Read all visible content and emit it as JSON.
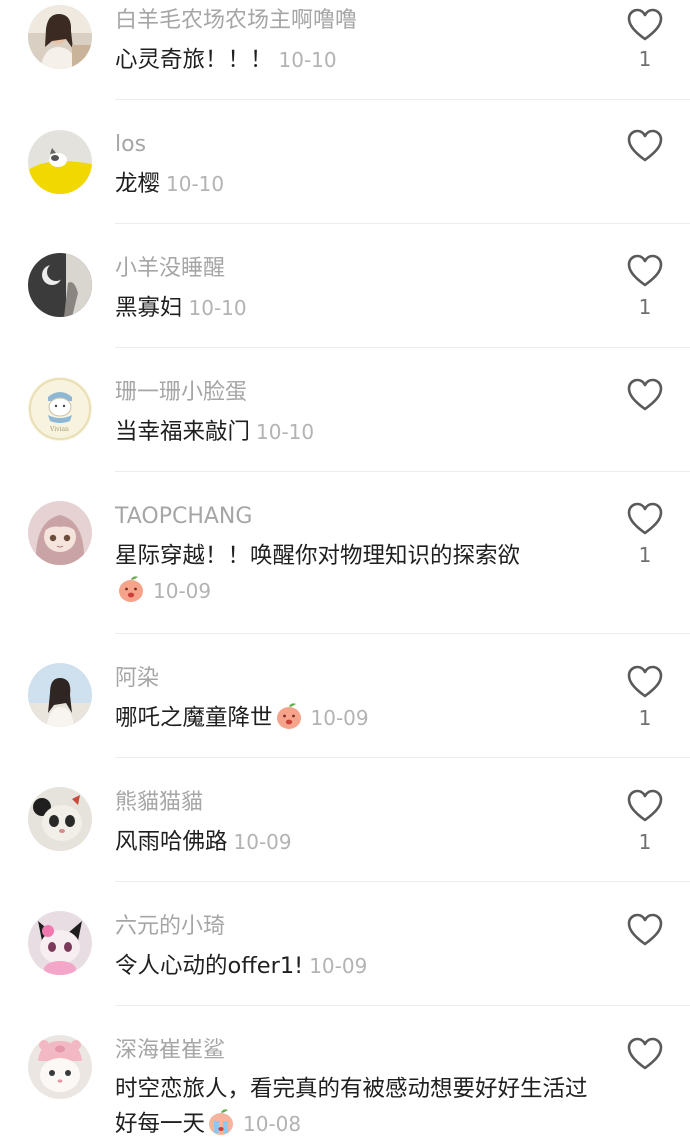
{
  "comments": [
    {
      "username": "白羊毛农场农场主啊噜噜",
      "text": "心灵奇旅！！！",
      "date": "10-10",
      "likes": "1",
      "avatar": "woman-selfie-avatar",
      "emoji": ""
    },
    {
      "username": "los",
      "text": "龙樱",
      "date": "10-10",
      "likes": "",
      "avatar": "yellow-cat-avatar",
      "emoji": ""
    },
    {
      "username": "小羊没睡醒",
      "text": "黑寡妇",
      "date": "10-10",
      "likes": "1",
      "avatar": "moon-dark-avatar",
      "emoji": ""
    },
    {
      "username": "珊一珊小脸蛋",
      "text": "当幸福来敲门",
      "date": "10-10",
      "likes": "",
      "avatar": "cartoon-scarf-avatar",
      "emoji": ""
    },
    {
      "username": "TAOPCHANG",
      "text": "星际穿越！！唤醒你对物理知识的探索欲",
      "date": "10-09",
      "likes": "1",
      "avatar": "anime-girl-avatar",
      "emoji": "peach-emoji"
    },
    {
      "username": "阿染",
      "text": "哪吒之魔童降世",
      "date": "10-09",
      "likes": "1",
      "avatar": "girl-sky-avatar",
      "emoji": "peach-emoji"
    },
    {
      "username": "熊貓猫貓",
      "text": "风雨哈佛路",
      "date": "10-09",
      "likes": "1",
      "avatar": "panda-cat-avatar",
      "emoji": ""
    },
    {
      "username": "六元的小琦",
      "text": "令人心动的offer1!",
      "date": "10-09",
      "likes": "",
      "avatar": "pink-plush-avatar",
      "emoji": ""
    },
    {
      "username": "深海崔崔鲨",
      "text": "时空恋旅人，看完真的有被感动想要好好生活过好每一天",
      "date": "10-08",
      "likes": "",
      "avatar": "pig-hat-cat-avatar",
      "emoji": "crying-peach-emoji"
    }
  ]
}
